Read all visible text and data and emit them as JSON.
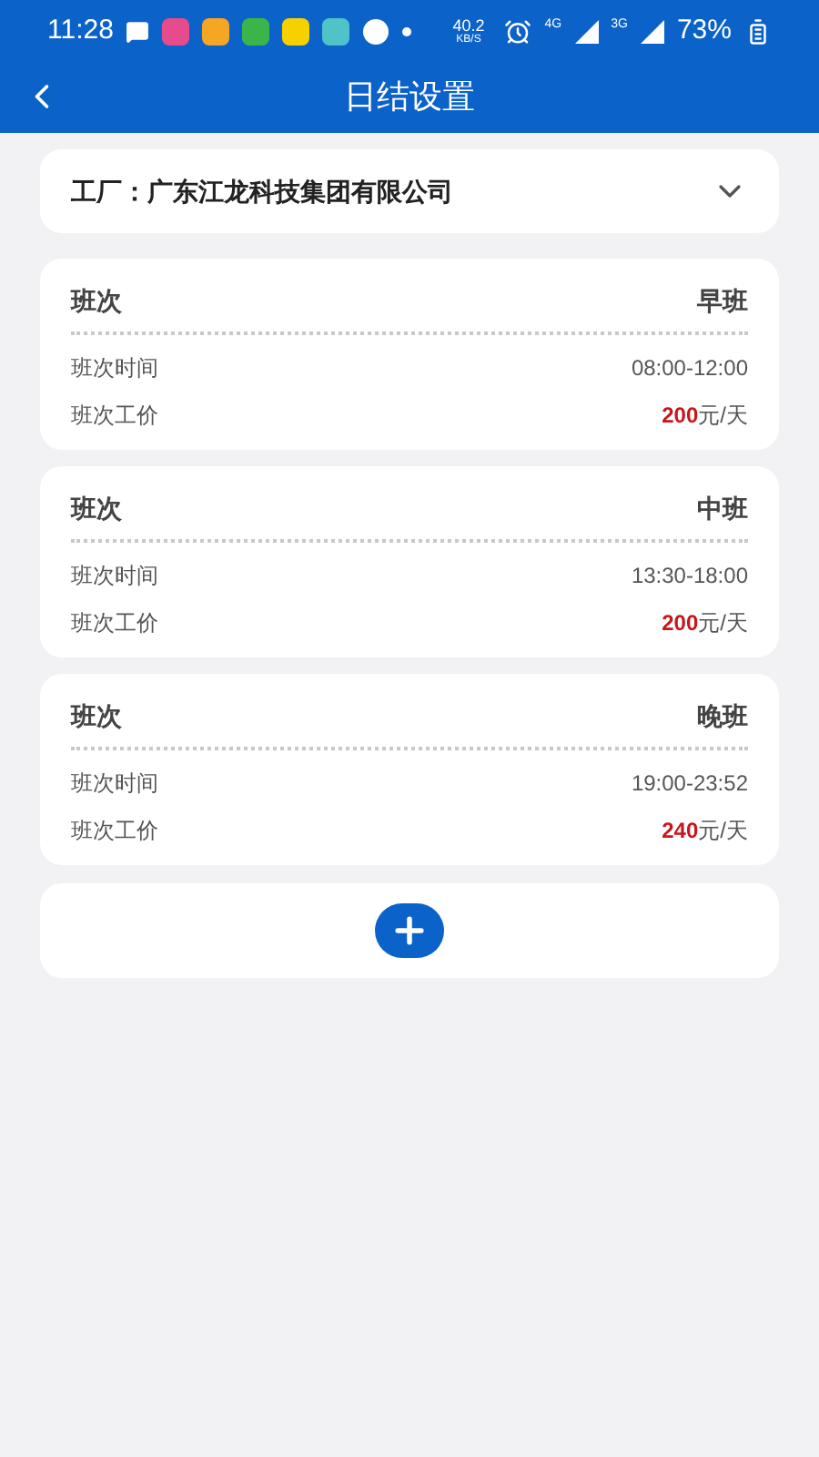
{
  "status_bar": {
    "time": "11:28",
    "speed": "40.2",
    "speed_unit": "KB/S",
    "network_1": "4G",
    "network_2": "3G",
    "battery": "73%"
  },
  "header": {
    "title": "日结设置"
  },
  "factory": {
    "label": "工厂：广东江龙科技集团有限公司"
  },
  "shifts": [
    {
      "label": "班次",
      "name": "早班",
      "time_label": "班次时间",
      "time": "08:00-12:00",
      "price_label": "班次工价",
      "amount": "200",
      "unit": "元/天"
    },
    {
      "label": "班次",
      "name": "中班",
      "time_label": "班次时间",
      "time": "13:30-18:00",
      "price_label": "班次工价",
      "amount": "200",
      "unit": "元/天"
    },
    {
      "label": "班次",
      "name": "晚班",
      "time_label": "班次时间",
      "time": "19:00-23:52",
      "price_label": "班次工价",
      "amount": "240",
      "unit": "元/天"
    }
  ]
}
